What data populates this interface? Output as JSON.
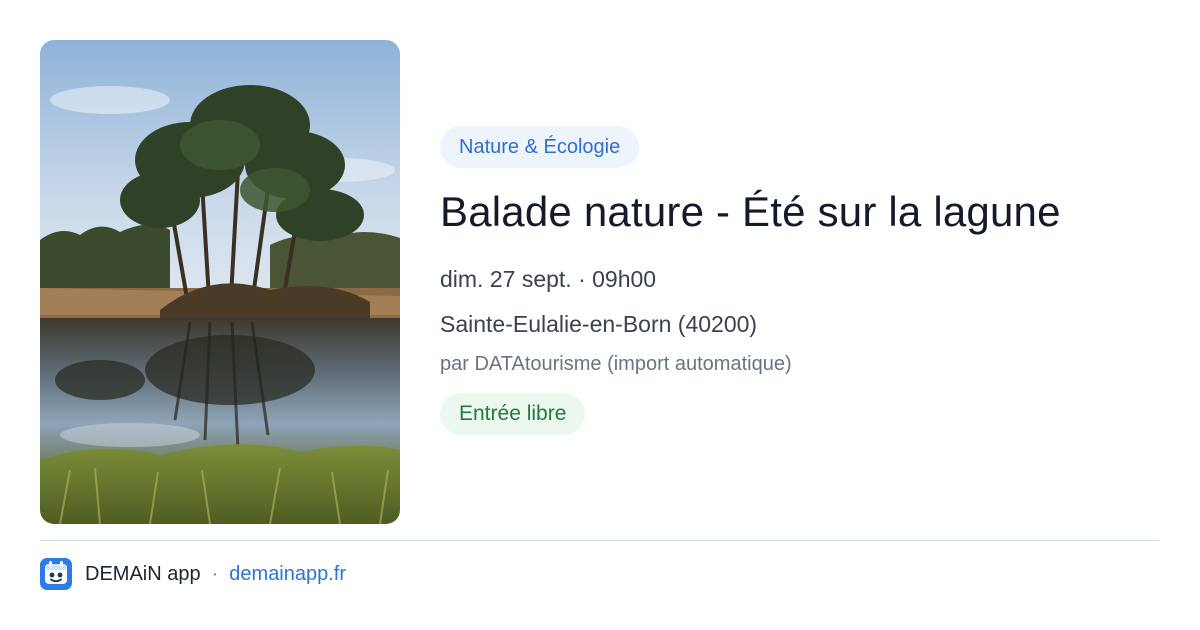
{
  "event": {
    "image_alt": "Lagune avec pins reflétés dans l'eau",
    "category": "Nature & Écologie",
    "title": "Balade nature - Été sur la lagune",
    "datetime": "dim. 27 sept. · 09h00",
    "location": "Sainte-Eulalie-en-Born (40200)",
    "organizer": "par DATAtourisme (import automatique)",
    "price": "Entrée libre"
  },
  "footer": {
    "app_name": "DEMAiN app",
    "separator": "·",
    "link_text": "demainapp.fr"
  },
  "colors": {
    "category_chip_bg": "#eef4fc",
    "category_chip_text": "#2f6fd0",
    "price_chip_bg": "#ecf8ef",
    "price_chip_text": "#237a3d",
    "title_text": "#141a2b",
    "link": "#2f73d6",
    "logo_blue": "#2d7be5"
  }
}
